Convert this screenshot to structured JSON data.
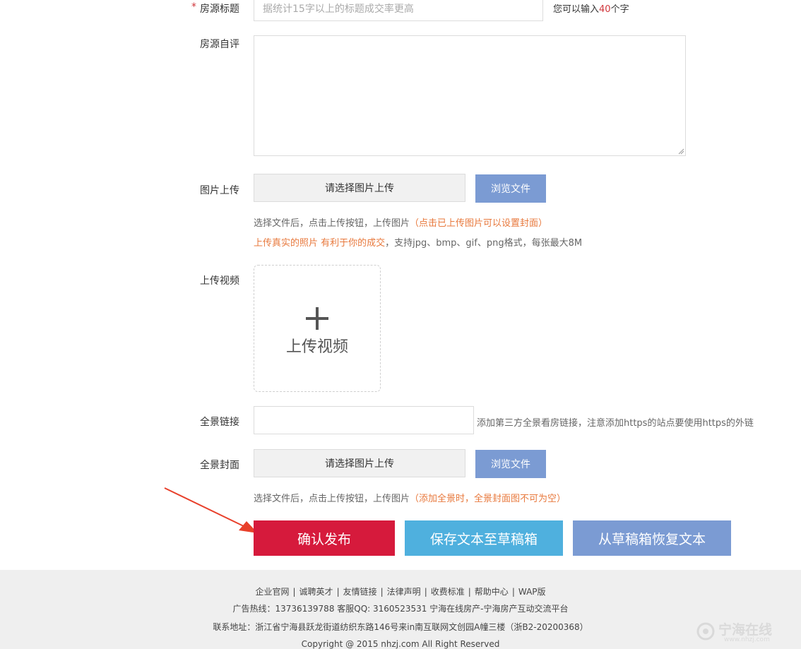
{
  "form": {
    "title": {
      "required_mark": "*",
      "label": "房源标题",
      "placeholder": "据统计15字以上的标题成交率更高",
      "hint_prefix": "您可以输入",
      "hint_count": "40",
      "hint_suffix": "个字"
    },
    "review": {
      "label": "房源自评"
    },
    "image_upload": {
      "label": "图片上传",
      "file_box_text": "请选择图片上传",
      "browse_label": "浏览文件",
      "hint1_main": "选择文件后，点击上传按钮，上传图片",
      "hint1_note": "（点击已上传图片可以设置封面）",
      "hint2_note": "上传真实的照片 有利于你的成交",
      "hint2_main": "，支持jpg、bmp、gif、png格式，每张最大8M"
    },
    "video_upload": {
      "label": "上传视频",
      "plus": "+",
      "text": "上传视频"
    },
    "panorama_link": {
      "label": "全景链接",
      "hint": "添加第三方全景看房链接，注意添加https的站点要使用https的外链"
    },
    "panorama_cover": {
      "label": "全景封面",
      "file_box_text": "请选择图片上传",
      "browse_label": "浏览文件",
      "hint_main": "选择文件后，点击上传按钮，上传图片",
      "hint_note": "（添加全景时，全景封面图不可为空）"
    },
    "buttons": {
      "publish": "确认发布",
      "save_draft": "保存文本至草稿箱",
      "restore_draft": "从草稿箱恢复文本"
    }
  },
  "footer": {
    "links": [
      "企业官网",
      "诚聘英才",
      "友情链接",
      "法律声明",
      "收费标准",
      "帮助中心",
      "WAP版"
    ],
    "separator": "|",
    "hotline": "广告热线：13736139788 客服QQ: 3160523531 宁海在线房产-宁海房产互动交流平台",
    "address": "联系地址：浙江省宁海县跃龙街道纺织东路146号来in南互联网文创园A幢三楼（浙B2-20200368）",
    "copyright": "Copyright @ 2015 nhzj.com All Right Reserved",
    "watermark_main": "宁海在线",
    "watermark_sub": "www.nhzj.com"
  },
  "colors": {
    "publish_button": "#d61a3c",
    "save_button": "#4fb0de",
    "restore_button": "#7b9bd3",
    "browse_button": "#7b9bd3",
    "annotation_arrow": "#e8402b",
    "hint_orange": "#e8793d",
    "count_red": "#d0363b"
  },
  "icons": {
    "annotation_arrow": "arrow-pointer-icon",
    "video_add": "plus-icon",
    "watermark_logo": "site-logo-icon"
  }
}
